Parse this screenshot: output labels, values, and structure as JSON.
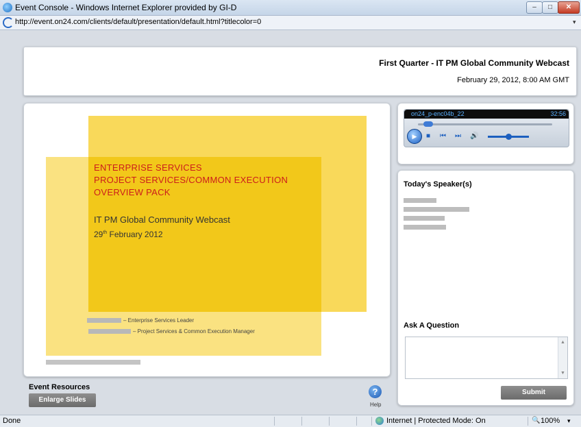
{
  "window": {
    "title": "Event Console - Windows Internet Explorer provided by GI-D",
    "minimize": "–",
    "maximize": "□",
    "close": "✕"
  },
  "address": {
    "url": "http://event.on24.com/clients/default/presentation/default.html?titlecolor=0",
    "dropdown": "▾"
  },
  "header": {
    "event_title": "First Quarter - IT PM Global Community Webcast",
    "event_date": "February 29, 2012, 8:00 AM GMT"
  },
  "slide": {
    "heading_lines": [
      "ENTERPRISE SERVICES",
      "PROJECT SERVICES/COMMON  EXECUTION",
      "OVERVIEW PACK"
    ],
    "subtitle": "IT PM Global Community Webcast",
    "date_day": "29",
    "date_suffix": "th",
    "date_rest": "February 2012",
    "presenter_1_role": "– Enterprise Services Leader",
    "presenter_2_role": "– Project Services & Common Execution Manager"
  },
  "resources": {
    "title": "Event Resources",
    "enlarge_label": "Enlarge Slides",
    "help_label": "Help",
    "help_glyph": "?"
  },
  "player": {
    "file": "on24_p-enc04b_22",
    "time": "32:56",
    "play_glyph": "▶",
    "stop_glyph": "■",
    "prev_glyph": "⏮",
    "next_glyph": "⏭",
    "vol_glyph": "🔊",
    "seek_position": 0.05,
    "volume_level": 0.5
  },
  "sidebar": {
    "speakers_title": "Today's Speaker(s)",
    "question_title": "Ask A Question",
    "submit_label": "Submit",
    "scroll_up": "▲",
    "scroll_down": "▼"
  },
  "status": {
    "left": "Done",
    "zone": "Internet | Protected Mode: On",
    "zoom": "100%",
    "zoom_icon": "🔍",
    "zoom_dropdown": "▾"
  },
  "colors": {
    "slide_yellow": "#f6cb1a",
    "slide_red": "#cc1c1c",
    "button_gray": "#7a7a7a",
    "accent_blue": "#1c5fbf"
  }
}
